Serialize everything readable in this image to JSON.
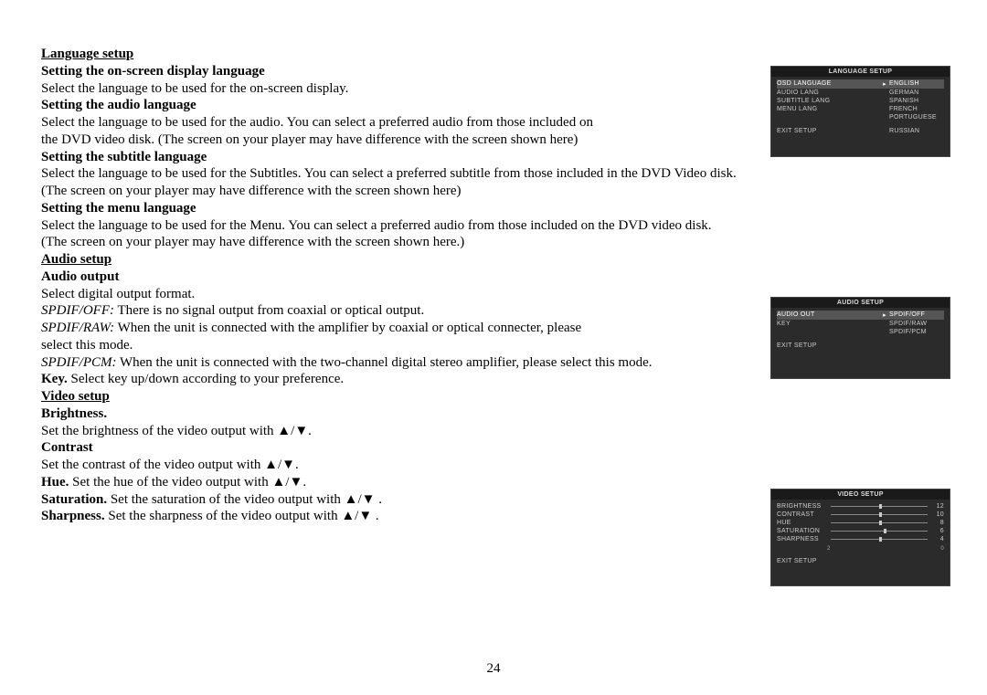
{
  "pageNumber": "24",
  "sections": {
    "langSetupTitle": "Language setup",
    "osdLangHeading": "Setting the on-screen display language",
    "osdLangText": "Select the language to be used for the on-screen display.",
    "audioLangHeading": "Setting the audio language",
    "audioLangText1": "Select the language to be used for the audio. You can select a preferred audio from those included on",
    "audioLangText2": "the DVD video disk. (The screen on your player may have difference with the screen shown here)",
    "subtitleHeading": "Setting the subtitle language",
    "subtitleText1": "Select the language to be used for the Subtitles. You can select a preferred subtitle from those included in the DVD Video disk.",
    "subtitleText2": "(The screen on your player may have difference with the screen shown here)",
    "menuLangHeading": "Setting the menu language",
    "menuLangText1": "Select the language to be used for the Menu. You can select a preferred audio from those included on the DVD video disk.",
    "menuLangText2": "(The screen on your player may have difference with the screen shown here.)",
    "audioSetupTitle": "Audio setup",
    "audioOutputHeading": "Audio output",
    "audioOutputText": "Select digital output format.",
    "spdifOffLabel": "SPDIF/OFF:",
    "spdifOffText": " There is no signal output from coaxial or optical output.",
    "spdifRawLabel": "SPDIF/RAW:",
    "spdifRawText1": " When the unit is connected with the amplifier by coaxial or optical connecter, please",
    "spdifRawText2": "select this mode.",
    "spdifPcmLabel": "SPDIF/PCM:",
    "spdifPcmText": " When the unit is connected with the two-channel digital stereo amplifier, please select this mode.",
    "keyLabel": "Key.",
    "keyText": " Select key up/down according to your preference.",
    "videoSetupTitle": "Video setup",
    "brightnessHeading": "Brightness.",
    "brightnessText": "Set the brightness of the video output with ▲/▼.",
    "contrastHeading": "Contrast",
    "contrastText": "Set the contrast of the video output with ▲/▼.",
    "hueLabel": "Hue.",
    "hueText": " Set the hue of the video output with ▲/▼.",
    "saturationLabel": "Saturation.",
    "saturationText": " Set the saturation of the video output with ▲/▼ .",
    "sharpnessLabel": "Sharpness.",
    "sharpnessText": " Set the sharpness of the video output with ▲/▼ ."
  },
  "osd1": {
    "title": "LANGUAGE SETUP",
    "rows": [
      {
        "l": "OSD LANGUAGE",
        "r": "ENGLISH",
        "highlight": true
      },
      {
        "l": "AUDIO LANG",
        "r": "GERMAN"
      },
      {
        "l": "SUBTITLE LANG",
        "r": "SPANISH"
      },
      {
        "l": "MENU LANG",
        "r": "FRENCH"
      },
      {
        "l": "",
        "r": "PORTUGUESE"
      }
    ],
    "exit": "EXIT SETUP",
    "exitRight": "RUSSIAN"
  },
  "osd2": {
    "title": "AUDIO SETUP",
    "rows": [
      {
        "l": "AUDIO OUT",
        "r": "SPDIF/OFF",
        "highlight": true
      },
      {
        "l": "KEY",
        "r": "SPDIF/RAW"
      },
      {
        "l": "",
        "r": "SPDIF/PCM"
      }
    ],
    "exit": "EXIT SETUP"
  },
  "osd3": {
    "title": "VIDEO SETUP",
    "rows": [
      {
        "l": "BRIGHTNESS",
        "pos": 50,
        "n": "12",
        "highlight": true
      },
      {
        "l": "CONTRAST",
        "pos": 50,
        "n": "10"
      },
      {
        "l": "HUE",
        "pos": 50,
        "n": "8"
      },
      {
        "l": "SATURATION",
        "pos": 55,
        "n": "6"
      },
      {
        "l": "SHARPNESS",
        "pos": 50,
        "n": "4"
      }
    ],
    "exit": "EXIT SETUP",
    "ticks": [
      "2",
      "0"
    ]
  }
}
